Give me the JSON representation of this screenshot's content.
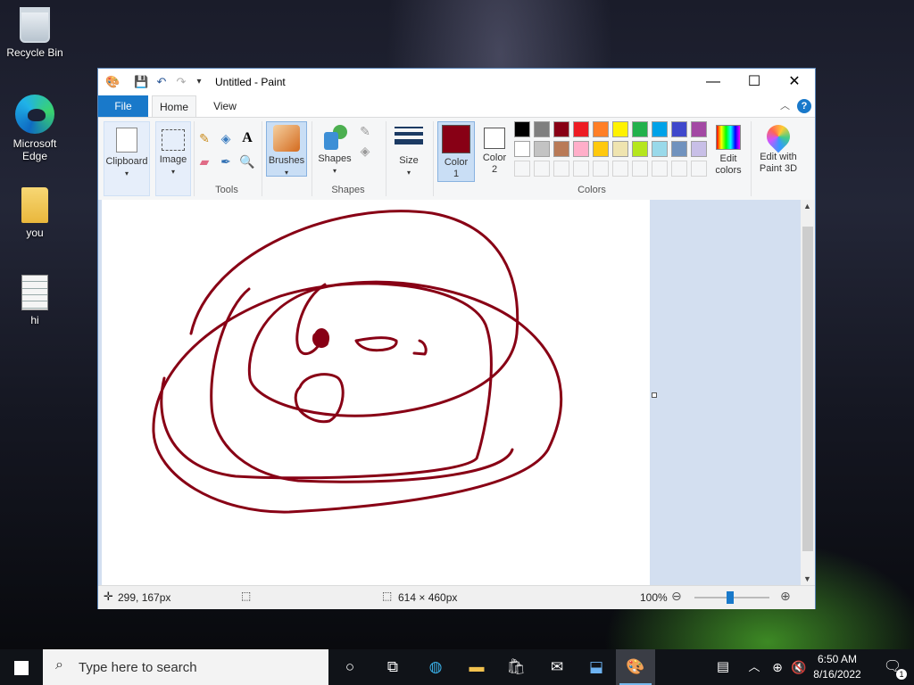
{
  "desktop": {
    "icons": [
      {
        "label": "Recycle Bin"
      },
      {
        "label": "Microsoft Edge"
      },
      {
        "label": "you"
      },
      {
        "label": "hi"
      }
    ]
  },
  "window": {
    "title": "Untitled - Paint",
    "tabs": [
      "File",
      "Home",
      "View"
    ],
    "help": "?",
    "ribbon": {
      "clipboard": "Clipboard",
      "image": "Image",
      "tools_group": "Tools",
      "brushes": "Brushes",
      "shapes": "Shapes",
      "shapes_group": "Shapes",
      "size": "Size",
      "color1": "Color 1",
      "color2": "Color 2",
      "colors_group": "Colors",
      "edit_colors": "Edit colors",
      "edit_paint3d": "Edit with Paint 3D",
      "text_tool": "A",
      "color1_value": "#880015",
      "color2_value": "#ffffff",
      "palette_row1": [
        "#000000",
        "#7f7f7f",
        "#880015",
        "#ed1c24",
        "#ff7f27",
        "#fff200",
        "#22b14c",
        "#00a2e8",
        "#3f48cc",
        "#a349a4"
      ],
      "palette_row2": [
        "#ffffff",
        "#c3c3c3",
        "#b97a57",
        "#ffaec9",
        "#ffc90e",
        "#efe4b0",
        "#b5e61d",
        "#99d9ea",
        "#7092be",
        "#c8bfe7"
      ]
    },
    "status": {
      "cursor_pos": "299, 167px",
      "canvas_size": "614 × 460px",
      "zoom": "100%"
    }
  },
  "taskbar": {
    "search_placeholder": "Type here to search",
    "time": "6:50 AM",
    "date": "8/16/2022",
    "notification_count": "1"
  }
}
